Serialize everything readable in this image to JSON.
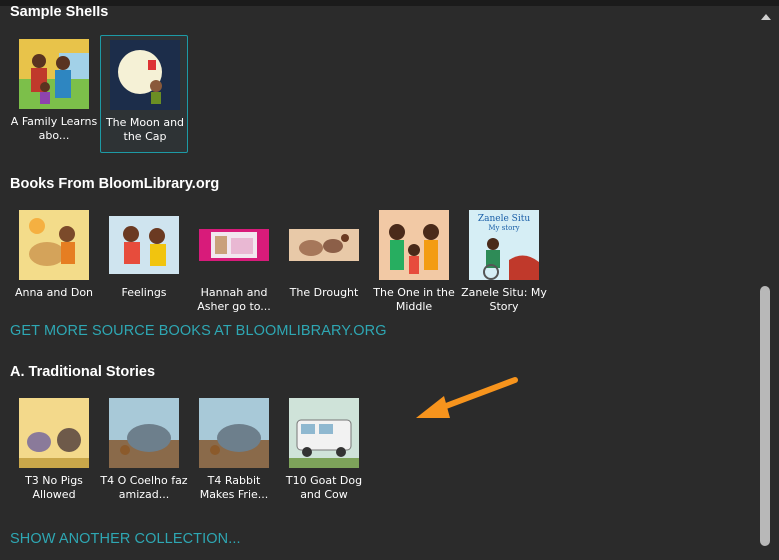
{
  "sections": {
    "sample_shells": {
      "title": "Sample Shells",
      "books": [
        {
          "title": "A Family Learns abo..."
        },
        {
          "title": "The Moon and the Cap"
        }
      ]
    },
    "bloomlibrary": {
      "title": "Books From BloomLibrary.org",
      "books": [
        {
          "title": "Anna and Don"
        },
        {
          "title": "Feelings"
        },
        {
          "title": "Hannah and Asher go to..."
        },
        {
          "title": "The Drought"
        },
        {
          "title": "The One in the Middle"
        },
        {
          "title": "Zanele Situ: My Story"
        }
      ],
      "link": "GET MORE SOURCE BOOKS AT BLOOMLIBRARY.ORG"
    },
    "traditional": {
      "title": "A. Traditional Stories",
      "books": [
        {
          "title": "T3 No Pigs Allowed"
        },
        {
          "title": "T4 O Coelho faz amizad..."
        },
        {
          "title": "T4 Rabbit Makes Frie..."
        },
        {
          "title": "T10 Goat Dog and Cow"
        }
      ]
    }
  },
  "footer_link": "SHOW ANOTHER COLLECTION...",
  "zanele_cover": {
    "line1": "Zanele Situ",
    "line2": "My story"
  },
  "scrollbar": {
    "position_fraction": 0.5,
    "visible_fraction": 0.5
  },
  "colors": {
    "background": "#2b2b2b",
    "link": "#2ea7b3",
    "selected_border": "#1d9aa5",
    "arrow": "#f7941d"
  }
}
